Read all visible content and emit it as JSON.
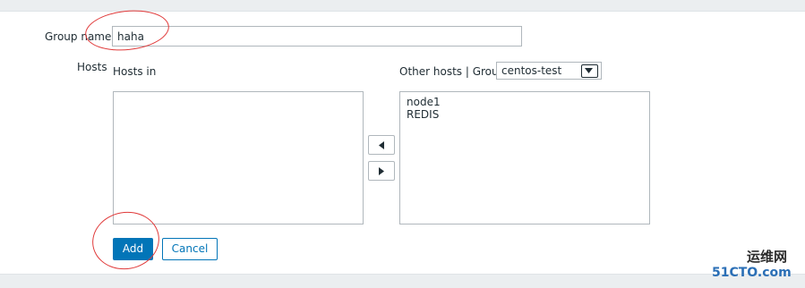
{
  "form": {
    "group_name_label": "Group name",
    "group_name_value": "haha",
    "hosts_label": "Hosts",
    "hosts_in_label": "Hosts in",
    "hosts_in_items": [],
    "other_hosts_label": "Other hosts | Group",
    "group_select_value": "centos-test",
    "other_hosts_items": [
      "node1",
      "REDIS"
    ]
  },
  "buttons": {
    "add_label": "Add",
    "cancel_label": "Cancel",
    "move_left_icon": "arrow-left-icon",
    "move_right_icon": "arrow-right-icon"
  },
  "watermark": {
    "line1": "运维网",
    "line2": "51CTO.com"
  },
  "colors": {
    "primary": "#0275b8",
    "annotation_red": "#e03a3a"
  }
}
